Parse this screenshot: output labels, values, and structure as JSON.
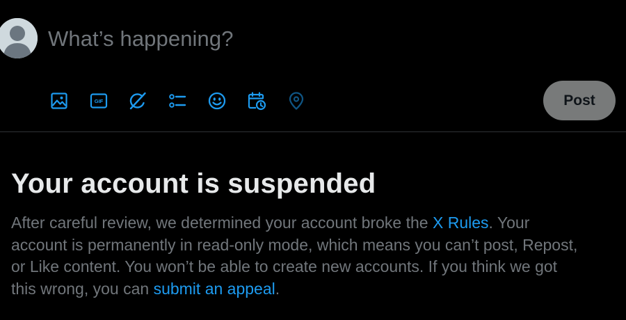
{
  "composer": {
    "placeholder": "What’s happening?",
    "post_label": "Post",
    "tools": [
      {
        "icon": "media-icon"
      },
      {
        "icon": "gif-icon",
        "text": "GIF"
      },
      {
        "icon": "grok-icon"
      },
      {
        "icon": "poll-icon"
      },
      {
        "icon": "emoji-icon"
      },
      {
        "icon": "schedule-icon"
      },
      {
        "icon": "location-icon"
      }
    ],
    "accent_color": "#1d9bf0",
    "post_button_color": "#787a7a"
  },
  "notice": {
    "title": "Your account is suspended",
    "body_1": "After careful review, we determined your account broke the ",
    "rules_link": "X Rules",
    "body_2": ". Your account is permanently in read-only mode, which means you can’t post, Repost, or Like content. You won’t be able to create new accounts. If you think we got this wrong, you can ",
    "appeal_link": "submit an appeal",
    "body_3": "."
  }
}
